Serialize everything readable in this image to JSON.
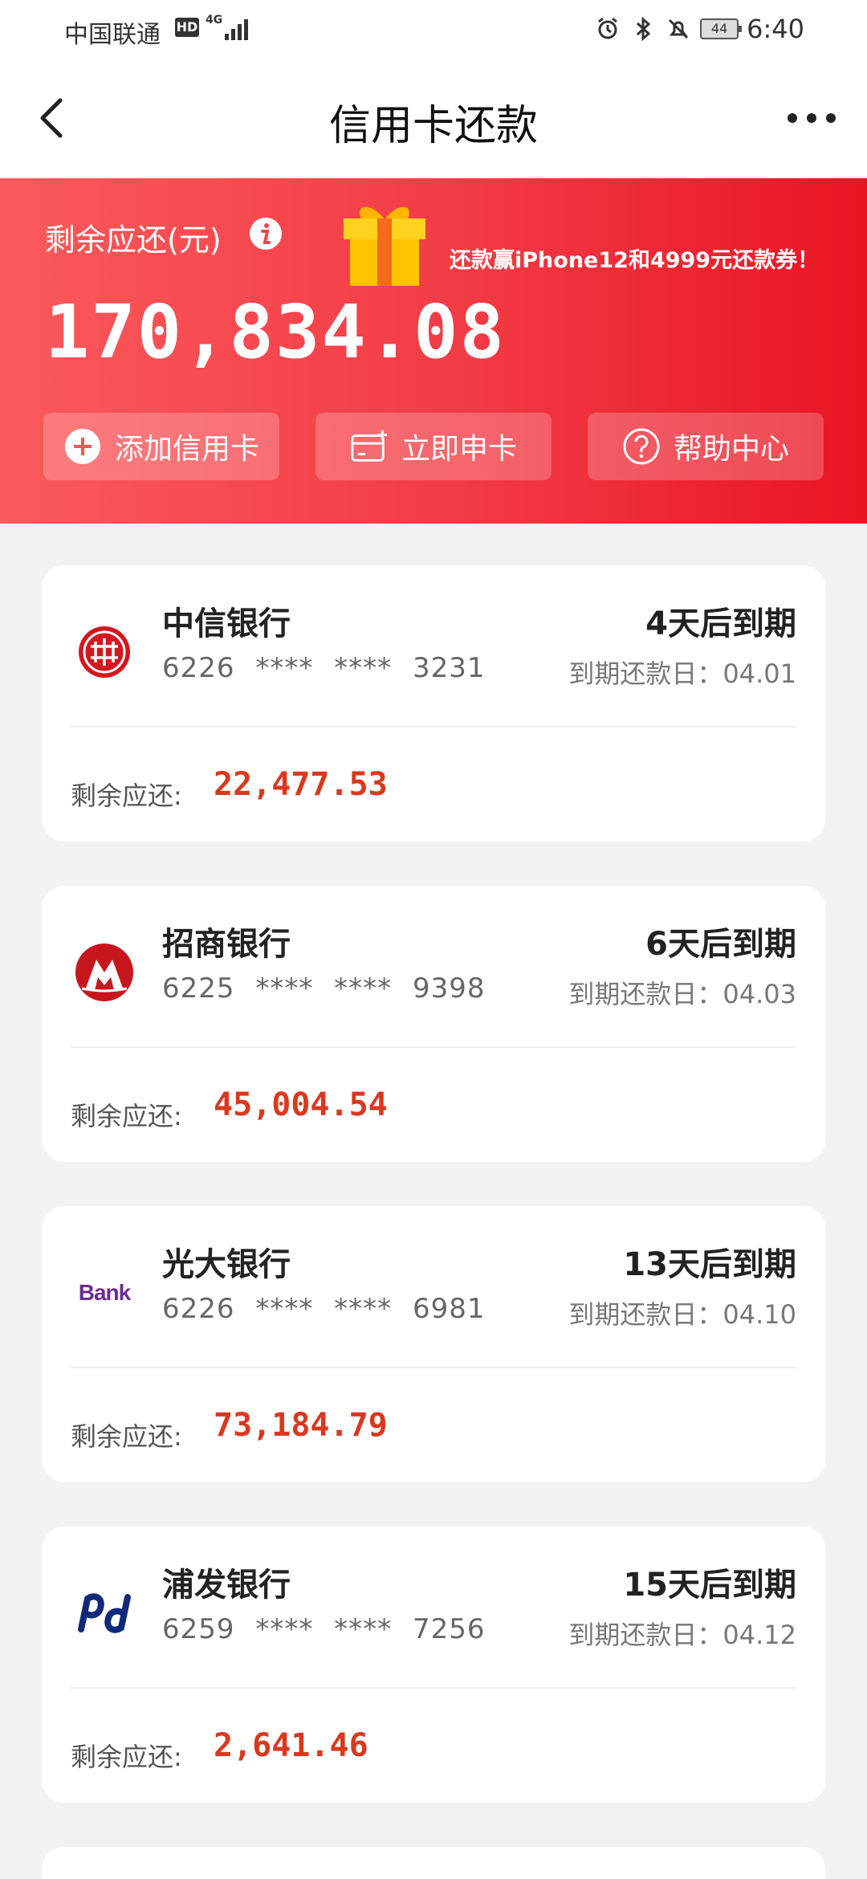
{
  "status_bar": {
    "carrier": "中国联通",
    "hd": "HD",
    "network": "4G",
    "battery": "44",
    "time": "6:40"
  },
  "nav": {
    "title": "信用卡还款"
  },
  "banner": {
    "remain_label": "剩余应还(元)",
    "promo_text": "还款赢iPhone12和4999元还款券！",
    "total_amount": "170,834.08",
    "buttons": [
      {
        "label": "添加信用卡",
        "icon": "plus-circle-icon"
      },
      {
        "label": "立即申卡",
        "icon": "card-add-icon"
      },
      {
        "label": "帮助中心",
        "icon": "help-icon"
      }
    ]
  },
  "cards": [
    {
      "bank": "中信银行",
      "number": "6226 **** **** 3231",
      "due_label": "4天后到期",
      "due_date": "到期还款日：04.01",
      "remain_label": "剩余应还:",
      "remain_amount": "22,477.53",
      "logo": "citic-logo"
    },
    {
      "bank": "招商银行",
      "number": "6225 **** **** 9398",
      "due_label": "6天后到期",
      "due_date": "到期还款日：04.03",
      "remain_label": "剩余应还:",
      "remain_amount": "45,004.54",
      "logo": "cmb-logo"
    },
    {
      "bank": "光大银行",
      "number": "6226 **** **** 6981",
      "due_label": "13天后到期",
      "due_date": "到期还款日：04.10",
      "remain_label": "剩余应还:",
      "remain_amount": "73,184.79",
      "logo": "ceb-logo",
      "logo_text": "Bank"
    },
    {
      "bank": "浦发银行",
      "number": "6259 **** **** 7256",
      "due_label": "15天后到期",
      "due_date": "到期还款日：04.12",
      "remain_label": "剩余应还:",
      "remain_amount": "2,641.46",
      "logo": "spdb-logo"
    }
  ],
  "colors": {
    "accent_red": "#ea1423",
    "amount_red": "#d9391f"
  }
}
